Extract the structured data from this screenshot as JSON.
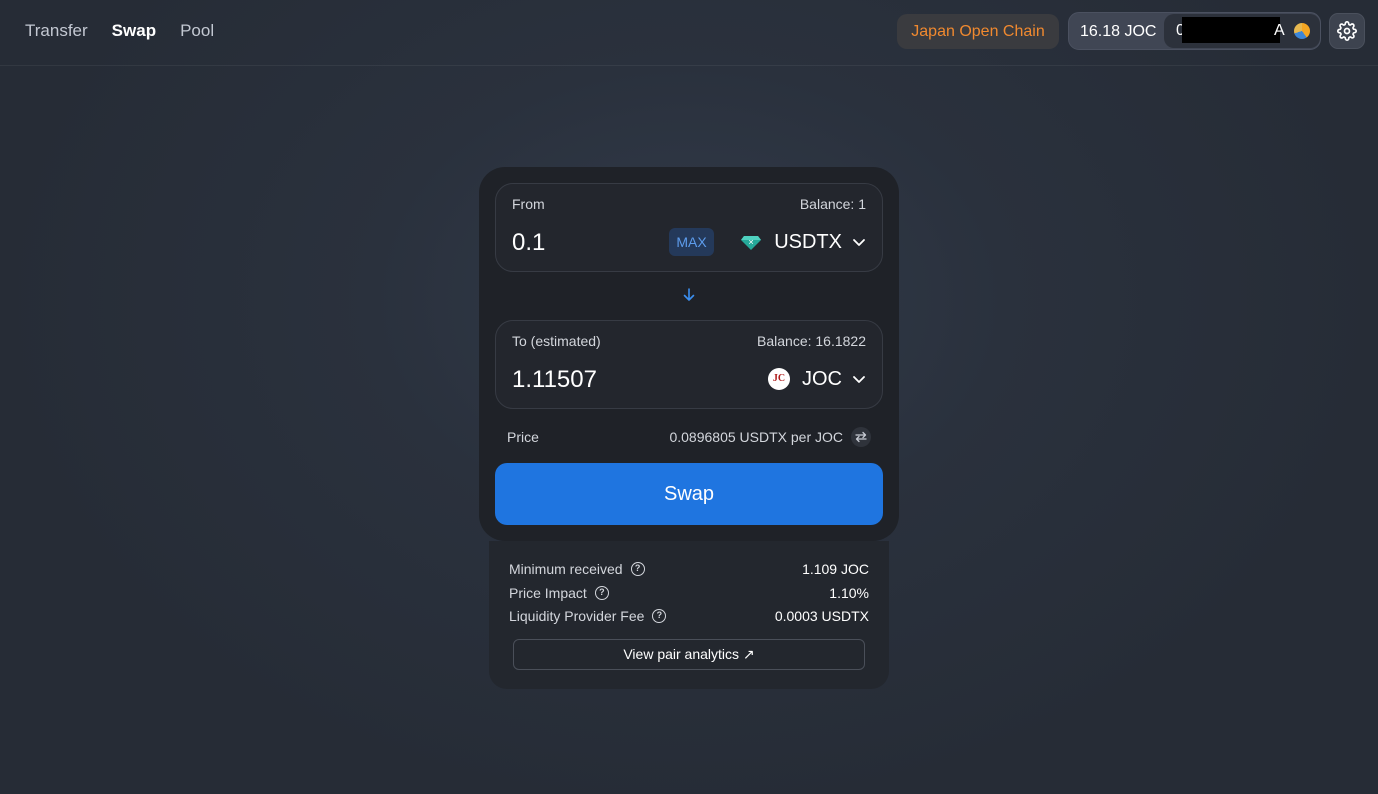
{
  "nav": {
    "items": [
      {
        "label": "Transfer",
        "active": false
      },
      {
        "label": "Swap",
        "active": true
      },
      {
        "label": "Pool",
        "active": false
      }
    ]
  },
  "header": {
    "network_label": "Japan Open Chain",
    "account_balance": "16.18 JOC",
    "account_address_head": "0",
    "account_address_tail": "A",
    "accent_color": "#f0892f"
  },
  "swap": {
    "from": {
      "label": "From",
      "balance": "Balance: 1",
      "amount": "0.1",
      "max_label": "MAX",
      "token": "USDTX"
    },
    "to": {
      "label": "To (estimated)",
      "balance": "Balance: 16.1822",
      "amount": "1.11507",
      "token": "JOC",
      "token_icon_text": "JC"
    },
    "price_label": "Price",
    "price_value": "0.0896805 USDTX per JOC",
    "button_label": "Swap",
    "button_color": "#1f75e0"
  },
  "details": {
    "minimum_received": {
      "label": "Minimum received",
      "value": "1.109 JOC"
    },
    "price_impact": {
      "label": "Price Impact",
      "value": "1.10%"
    },
    "lp_fee": {
      "label": "Liquidity Provider Fee",
      "value": "0.0003 USDTX"
    },
    "analytics_label": "View pair analytics ↗"
  }
}
